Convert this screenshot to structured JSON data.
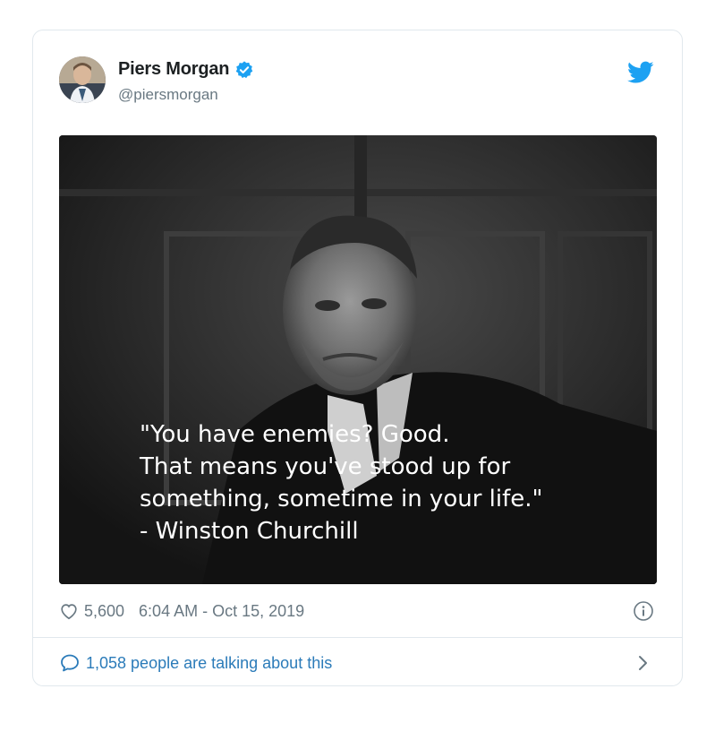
{
  "tweet": {
    "display_name": "Piers Morgan",
    "handle": "@piersmorgan",
    "verified": true,
    "quote_text": "\"You have enemies? Good.\nThat means you've stood up for\nsomething, sometime in your life.\"\n- Winston Churchill",
    "likes": "5,600",
    "timestamp": "6:04 AM - Oct 15, 2019",
    "talking": "1,058 people are talking about this"
  },
  "icons": {
    "brand": "twitter-bird-icon",
    "verified": "verified-badge-icon",
    "like": "heart-icon",
    "info": "info-icon",
    "reply": "speech-bubble-icon",
    "chevron": "chevron-right-icon"
  },
  "colors": {
    "brand_blue": "#1da1f2",
    "link_blue": "#2b7bb9",
    "secondary_text": "#697882",
    "border": "#e1e8ed"
  }
}
